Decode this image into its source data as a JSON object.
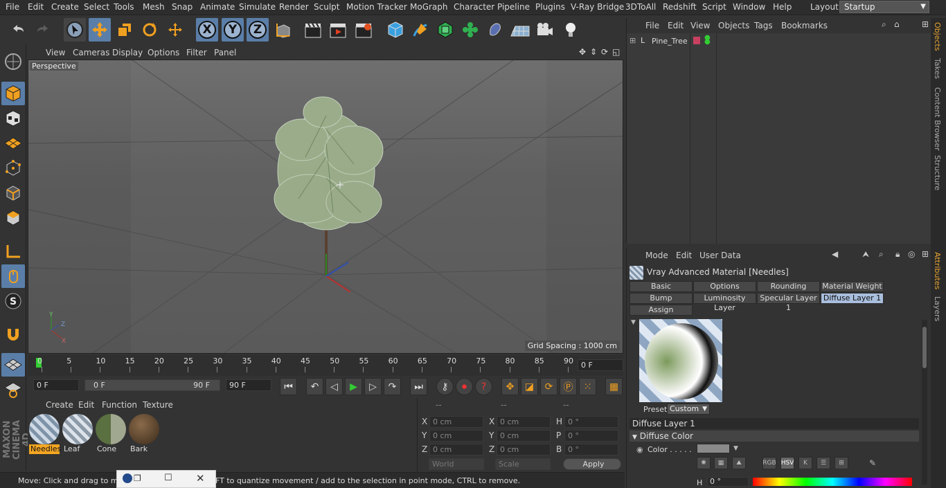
{
  "menubar": {
    "items": [
      "File",
      "Edit",
      "Create",
      "Select",
      "Tools",
      "Mesh",
      "Snap",
      "Animate",
      "Simulate",
      "Render",
      "Sculpt",
      "Motion Tracker",
      "MoGraph",
      "Character",
      "Pipeline",
      "Plugins",
      "V-Ray Bridge",
      "3DToAll",
      "Redshift",
      "Script",
      "Window",
      "Help"
    ],
    "layout_label": "Layout:",
    "layout_value": "Startup"
  },
  "viewport": {
    "menu": [
      "View",
      "Cameras",
      "Display",
      "Options",
      "Filter",
      "Panel"
    ],
    "label": "Perspective",
    "grid_spacing": "Grid Spacing : 1000 cm",
    "axis": {
      "x": "X",
      "y": "Y",
      "z": "Z"
    }
  },
  "timeline": {
    "ticks": [
      "0",
      "5",
      "10",
      "15",
      "20",
      "25",
      "30",
      "35",
      "40",
      "45",
      "50",
      "55",
      "60",
      "65",
      "70",
      "75",
      "80",
      "85",
      "90"
    ],
    "current_frame": "0 F",
    "start_field": "0 F",
    "range_start": "0 F",
    "range_end": "90 F",
    "end_field": "90 F"
  },
  "material_manager": {
    "menu": [
      "Create",
      "Edit",
      "Function",
      "Texture"
    ],
    "materials": [
      {
        "name": "Needles",
        "selected": true
      },
      {
        "name": "Leaf",
        "selected": false
      },
      {
        "name": "Cone",
        "selected": false
      },
      {
        "name": "Bark",
        "selected": false
      }
    ]
  },
  "coordinates": {
    "headers": [
      "--",
      "--",
      "--"
    ],
    "rows": [
      {
        "a": "X",
        "av": "0 cm",
        "b": "X",
        "bv": "0 cm",
        "c": "H",
        "cv": "0 °"
      },
      {
        "a": "Y",
        "av": "0 cm",
        "b": "Y",
        "bv": "0 cm",
        "c": "P",
        "cv": "0 °"
      },
      {
        "a": "Z",
        "av": "0 cm",
        "b": "Z",
        "bv": "0 cm",
        "c": "B",
        "cv": "0 °"
      }
    ],
    "world": "World",
    "scale": "Scale",
    "apply": "Apply"
  },
  "status": {
    "text": "Move: Click and drag to mo",
    "text_tail": "FT to quantize movement / add to the selection in point mode, CTRL to remove."
  },
  "object_manager": {
    "menu": [
      "File",
      "Edit",
      "View",
      "Objects",
      "Tags",
      "Bookmarks"
    ],
    "objects": [
      {
        "name": "Pine_Tree"
      }
    ]
  },
  "attribute_manager": {
    "menu": [
      "Mode",
      "Edit",
      "User Data"
    ],
    "title": "Vray Advanced Material [Needles]",
    "tabs_row1": [
      "Basic",
      "Options",
      "Rounding",
      "Material Weight"
    ],
    "tabs_row2": [
      "Bump",
      "Luminosity Layer",
      "Specular Layer 1",
      "Diffuse Layer 1"
    ],
    "tabs_row3": [
      "Assign"
    ],
    "active_tab": "Diffuse Layer 1",
    "preset_label": "Preset",
    "preset_value": "Custom",
    "section": "Diffuse Layer 1",
    "subsection": "Diffuse Color",
    "color_label": "Color . . . . .",
    "color_modes": [
      "RGB",
      "HSV",
      "K"
    ],
    "h_label": "H",
    "h_value": "0 °"
  },
  "right_tabs": [
    "Objects",
    "Takes",
    "Content Browser",
    "Structure",
    "Attributes",
    "Layers"
  ],
  "colors": {
    "accent": "#5a7ea8",
    "selected_material": "#f5a623",
    "active_tab": "#a9bedd"
  }
}
